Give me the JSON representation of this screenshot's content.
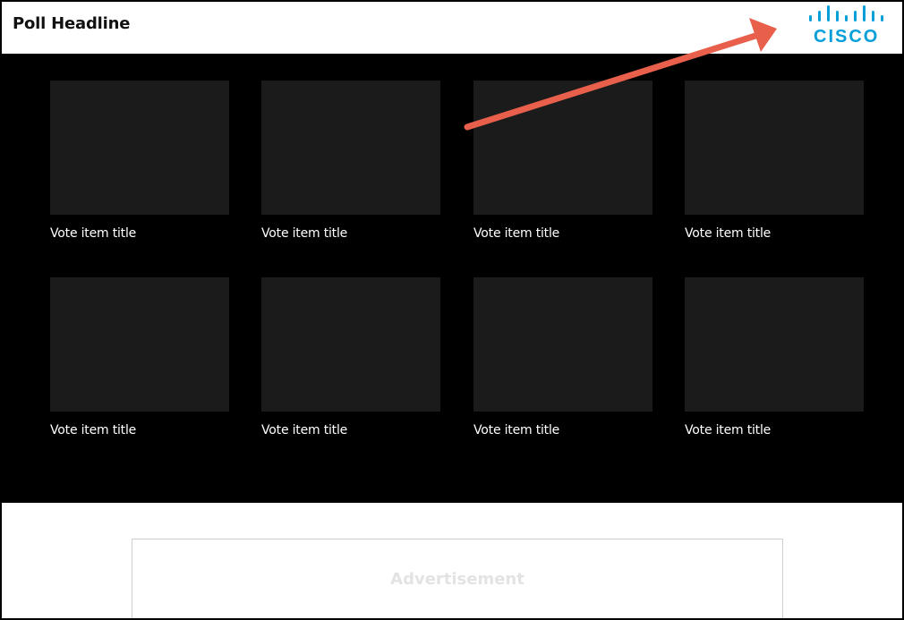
{
  "header": {
    "headline": "Poll Headline",
    "logo_text": "CISCO",
    "logo_icon": "cisco-logo-bars-icon"
  },
  "vote_items": [
    {
      "title": "Vote item title"
    },
    {
      "title": "Vote item title"
    },
    {
      "title": "Vote item title"
    },
    {
      "title": "Vote item title"
    },
    {
      "title": "Vote item title"
    },
    {
      "title": "Vote item title"
    },
    {
      "title": "Vote item title"
    },
    {
      "title": "Vote item title"
    }
  ],
  "advertisement": {
    "label": "Advertisement"
  },
  "colors": {
    "brand": "#049fd9",
    "annotation_arrow": "#e8604c",
    "grid_background": "#000000",
    "thumb_placeholder": "#1b1b1b"
  }
}
